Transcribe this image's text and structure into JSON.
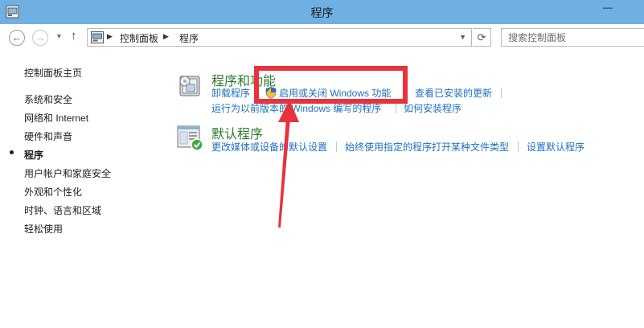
{
  "window": {
    "title": "程序",
    "minimize_label": "—"
  },
  "address_bar": {
    "breadcrumbs": [
      "控制面板",
      "程序"
    ],
    "search_placeholder": "搜索控制面板",
    "icons": {
      "back": "arrow-left-icon",
      "forward": "arrow-right-icon",
      "up": "arrow-up-icon",
      "refresh": "refresh-icon"
    }
  },
  "sidebar": {
    "home": "控制面板主页",
    "items": [
      {
        "label": "系统和安全",
        "active": false
      },
      {
        "label": "网络和 Internet",
        "active": false
      },
      {
        "label": "硬件和声音",
        "active": false
      },
      {
        "label": "程序",
        "active": true
      },
      {
        "label": "用户帐户和家庭安全",
        "active": false
      },
      {
        "label": "外观和个性化",
        "active": false
      },
      {
        "label": "时钟、语言和区域",
        "active": false
      },
      {
        "label": "轻松使用",
        "active": false
      }
    ]
  },
  "categories": [
    {
      "title": "程序和功能",
      "icon": "programs-features-icon",
      "links": [
        "卸载程序",
        "启用或关闭 Windows 功能",
        "查看已安装的更新",
        "运行为以前版本的 Windows 编写的程序",
        "如何安装程序"
      ]
    },
    {
      "title": "默认程序",
      "icon": "default-programs-icon",
      "links": [
        "更改媒体或设备的默认设置",
        "始终使用指定的程序打开某种文件类型",
        "设置默认程序"
      ]
    }
  ],
  "colors": {
    "titlebar": "#6fb0e2",
    "link": "#1f6fbf",
    "category_title": "#2c7a2c",
    "annotation": "#e8323c"
  }
}
